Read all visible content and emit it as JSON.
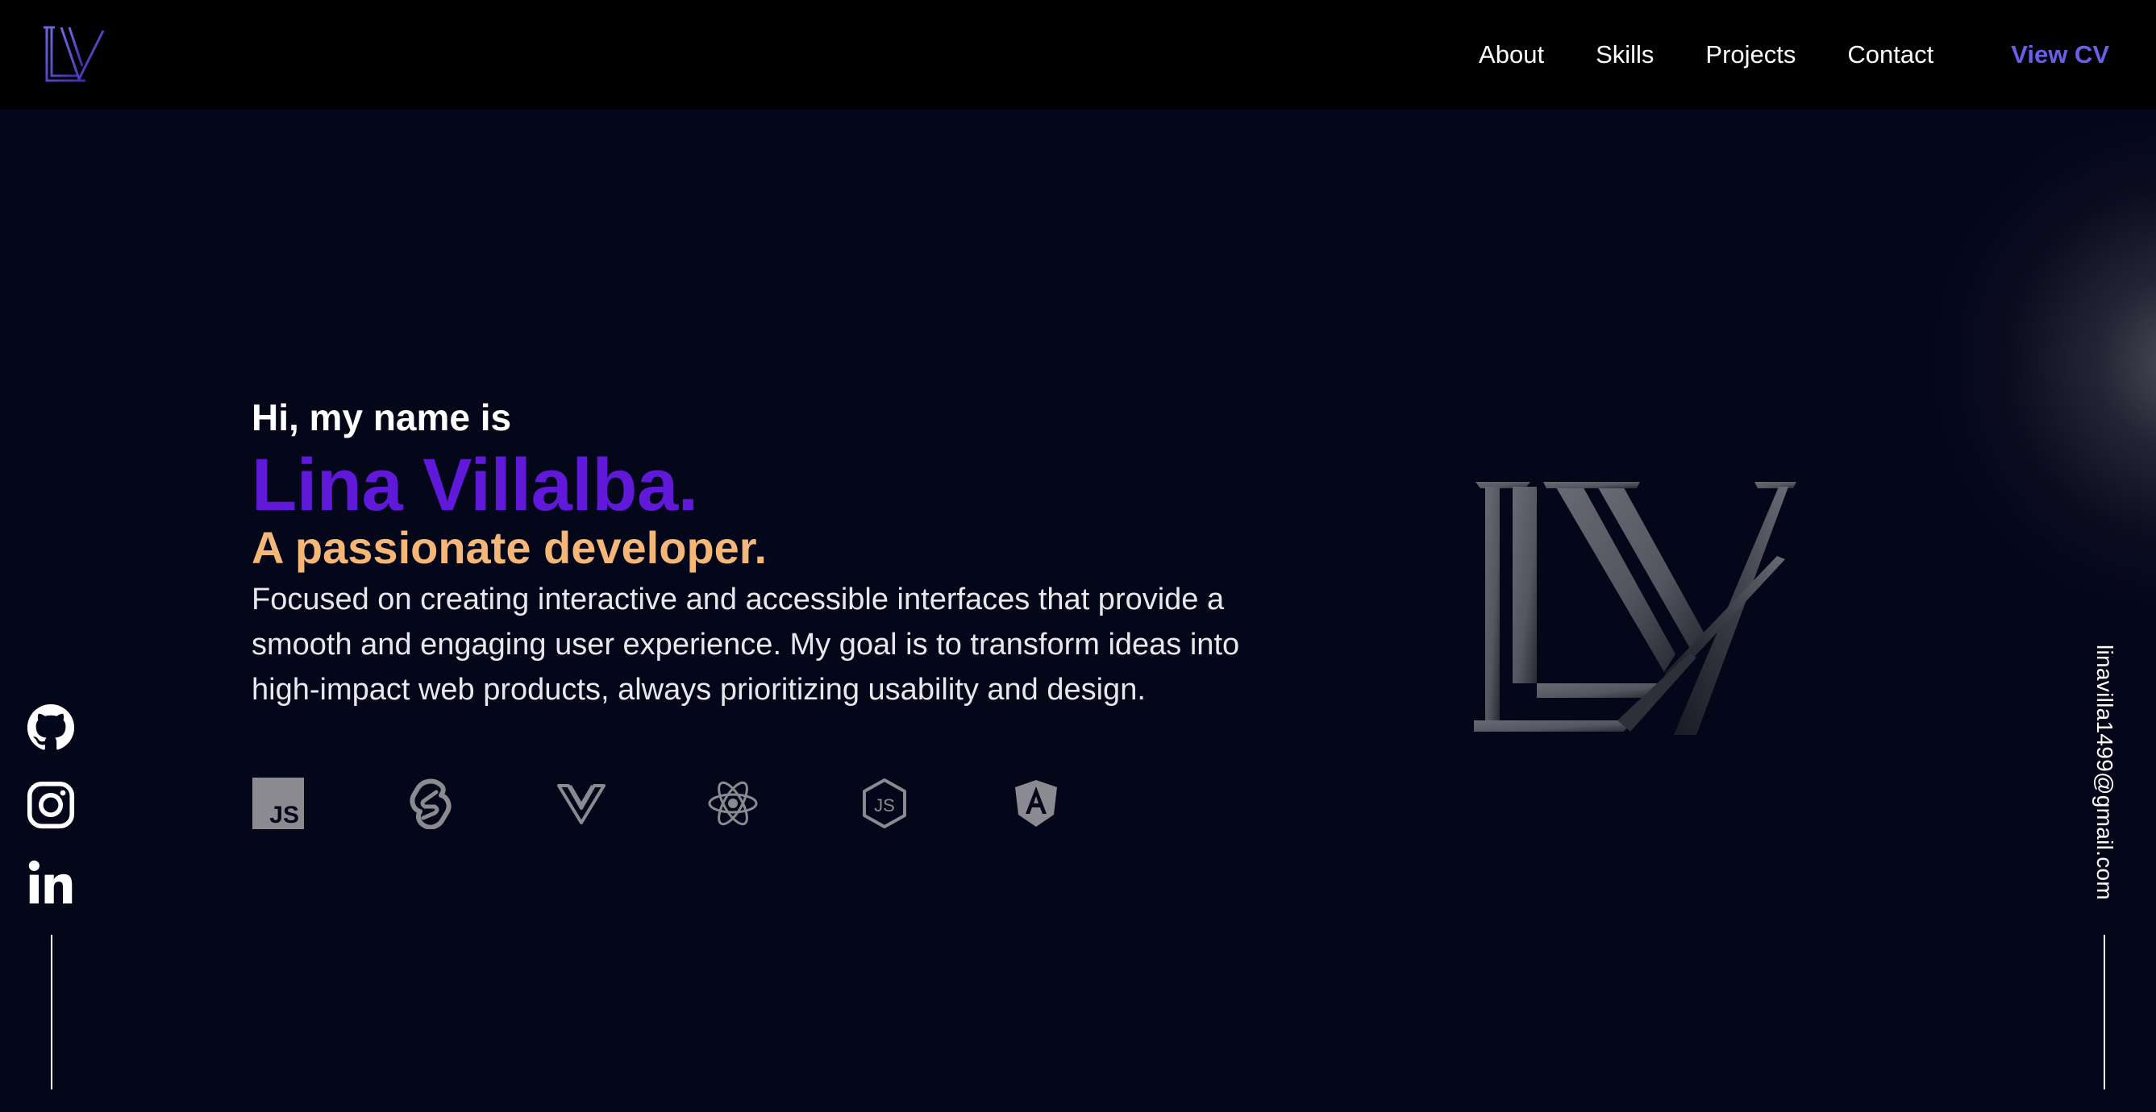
{
  "header": {
    "logo": "LV",
    "nav": [
      {
        "label": "About"
      },
      {
        "label": "Skills"
      },
      {
        "label": "Projects"
      },
      {
        "label": "Contact"
      }
    ],
    "cv_label": "View CV"
  },
  "hero": {
    "greeting": "Hi, my name is",
    "name": "Lina Villalba.",
    "tagline": "A passionate developer.",
    "description": "Focused on creating interactive and accessible interfaces that provide a smooth and engaging user experience. My goal is to transform ideas into high-impact web products, always prioritizing usability and design.",
    "tech_icons": [
      "javascript-icon",
      "svelte-icon",
      "vue-icon",
      "react-icon",
      "nodejs-icon",
      "angular-icon"
    ]
  },
  "socials": [
    "github-icon",
    "instagram-icon",
    "linkedin-icon"
  ],
  "email": "linavilla1499@gmail.com",
  "colors": {
    "background": "#04061a",
    "header": "#000000",
    "accent_purple": "#6019d8",
    "cv_link": "#6a5fe8",
    "tagline_orange": "#f5b778",
    "icon_gray": "#8a8a90",
    "logo_gray": "#5c5c66"
  }
}
